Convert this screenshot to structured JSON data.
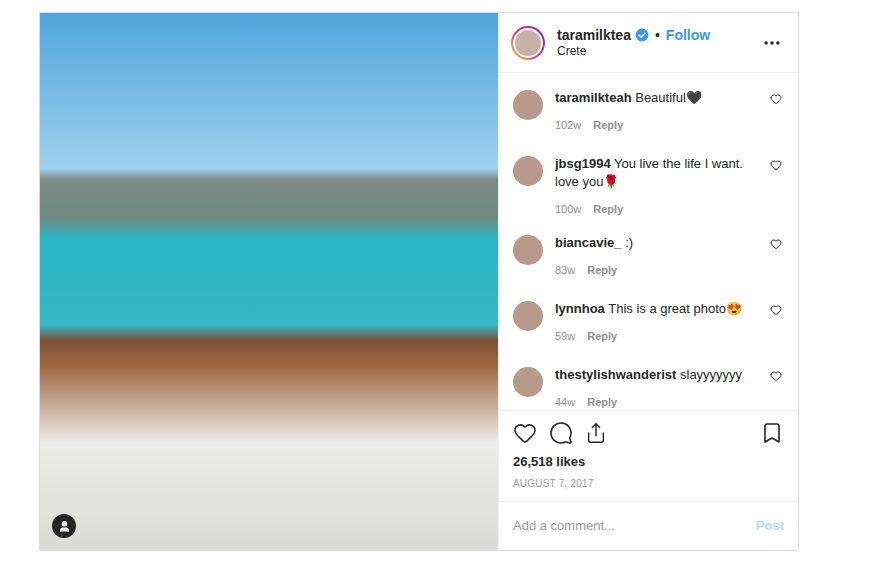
{
  "post": {
    "username": "taramilktea",
    "verified": true,
    "separator": "•",
    "follow": "Follow",
    "location": "Crete",
    "liked": false,
    "saved": false,
    "likes": "26,518 likes",
    "date": "AUGUST 7, 2017"
  },
  "comments": [
    {
      "username": "taramilkteah",
      "text": "Beautiful🖤",
      "age": "102w",
      "reply": "Reply",
      "liked": false
    },
    {
      "username": "jbsg1994",
      "text": "You live the life I want. love you🌹",
      "age": "100w",
      "reply": "Reply",
      "liked": false
    },
    {
      "username": "biancavie_",
      "text": ":)",
      "age": "83w",
      "reply": "Reply",
      "liked": false
    },
    {
      "username": "lynnhoa",
      "text": "This is a great photo😍",
      "age": "59w",
      "reply": "Reply",
      "liked": false
    },
    {
      "username": "thestylishwanderist",
      "text": "slayyyyyyy",
      "age": "44w",
      "reply": "Reply",
      "liked": false
    }
  ],
  "comment_field": {
    "placeholder": "Add a comment..."
  },
  "post_button": {
    "label": "Post",
    "disabled": true
  }
}
